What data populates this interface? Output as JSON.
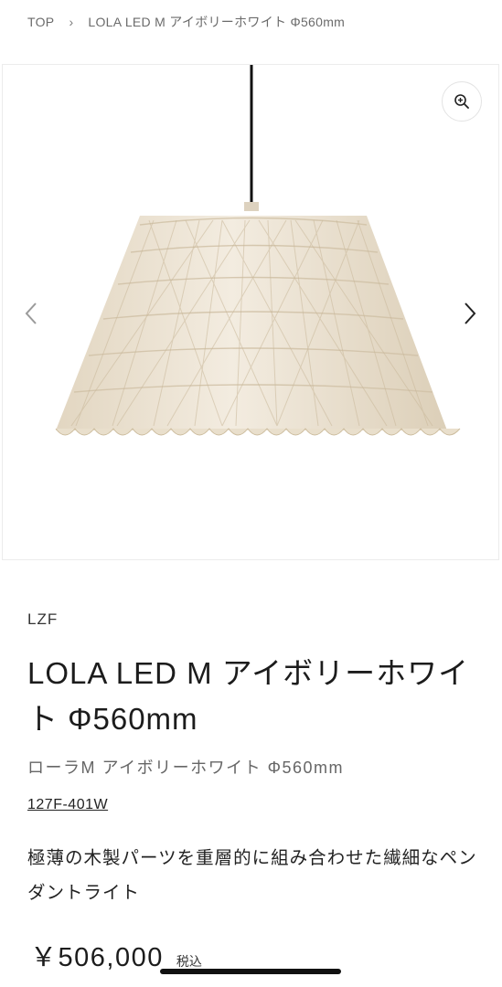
{
  "breadcrumb": {
    "home": "TOP",
    "separator": "›",
    "current": "LOLA LED M アイボリーホワイト Φ560mm"
  },
  "gallery": {
    "zoom_icon": "zoom-in-icon",
    "prev_icon": "chevron-left-icon",
    "next_icon": "chevron-right-icon",
    "lamp_color": "#eee4d3"
  },
  "product": {
    "vendor": "LZF",
    "title": "LOLA LED M アイボリーホワイト Φ560mm",
    "subtitle": "ローラM アイボリーホワイト Φ560mm",
    "sku": "127F-401W",
    "description": "極薄の木製パーツを重層的に組み合わせた繊細なペンダントライト",
    "price": "￥506,000",
    "tax_label": "税込"
  }
}
